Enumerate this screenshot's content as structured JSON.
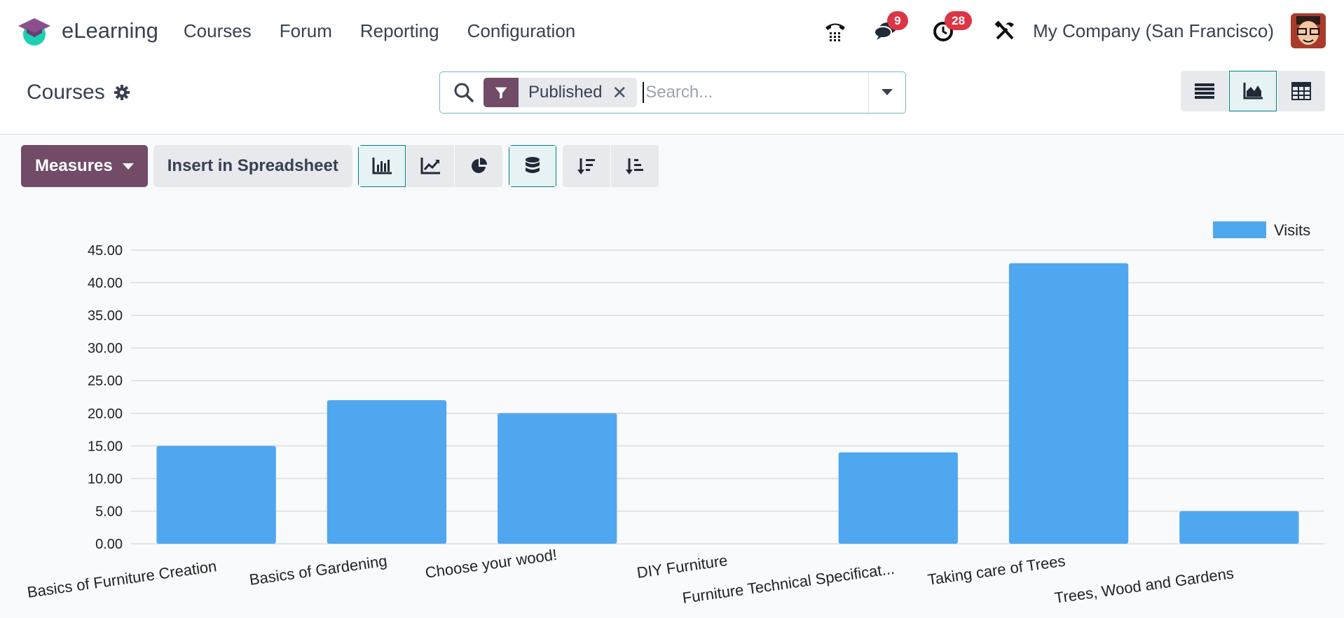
{
  "app": {
    "name": "eLearning"
  },
  "menu": [
    "Courses",
    "Forum",
    "Reporting",
    "Configuration"
  ],
  "systray": {
    "phone_icon": "phone-icon",
    "messages_count": "9",
    "activities_count": "28",
    "company": "My Company (San Francisco)"
  },
  "control_panel": {
    "title": "Courses",
    "search": {
      "facet": "Published",
      "placeholder": "Search..."
    }
  },
  "toolbar": {
    "measures_label": "Measures",
    "insert_label": "Insert in Spreadsheet"
  },
  "colors": {
    "accent": "#714b67",
    "bar": "#4fa7f0",
    "teal": "#017e84"
  },
  "chart_data": {
    "type": "bar",
    "categories": [
      "Basics of Furniture Creation",
      "Basics of Gardening",
      "Choose your wood!",
      "DIY Furniture",
      "Furniture Technical Specificat...",
      "Taking care of Trees",
      "Trees, Wood and Gardens"
    ],
    "series": [
      {
        "name": "Visits",
        "values": [
          15,
          22,
          20,
          0,
          14,
          43,
          5
        ]
      }
    ],
    "ylim": [
      0,
      45
    ],
    "yticks": [
      "0.00",
      "5.00",
      "10.00",
      "15.00",
      "20.00",
      "25.00",
      "30.00",
      "35.00",
      "40.00",
      "45.00"
    ],
    "grid": true,
    "legend": "top-right"
  }
}
